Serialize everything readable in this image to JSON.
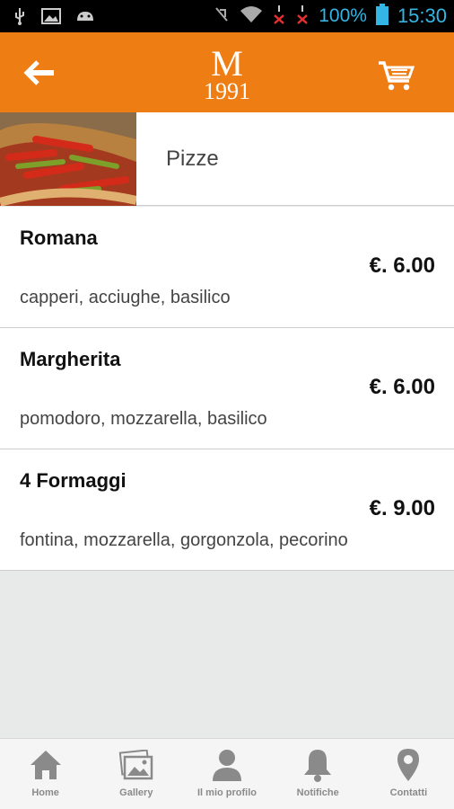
{
  "status_bar": {
    "battery": "100%",
    "time": "15:30",
    "icons": [
      "usb-icon",
      "image-icon",
      "android-icon",
      "mute-icon",
      "wifi-icon",
      "signal-off-icon",
      "signal-off-icon",
      "battery-icon"
    ],
    "accent_color": "#33b5e5"
  },
  "app_bar": {
    "color": "#ee7d14",
    "logo_letter": "M",
    "logo_year": "1991",
    "back_icon": "back-arrow-icon",
    "cart_icon": "cart-icon"
  },
  "category": {
    "title": "Pizze",
    "image": "pizza-photo"
  },
  "items": [
    {
      "name": "Romana",
      "price": "€. 6.00",
      "description": "capperi, acciughe, basilico"
    },
    {
      "name": "Margherita",
      "price": "€. 6.00",
      "description": "pomodoro, mozzarella, basilico"
    },
    {
      "name": "4 Formaggi",
      "price": "€. 9.00",
      "description": "fontina, mozzarella, gorgonzola, pecorino"
    }
  ],
  "bottom_nav": {
    "items": [
      {
        "label": "Home",
        "icon": "home-icon"
      },
      {
        "label": "Gallery",
        "icon": "gallery-icon"
      },
      {
        "label": "Il mio profilo",
        "icon": "profile-icon"
      },
      {
        "label": "Notifiche",
        "icon": "bell-icon"
      },
      {
        "label": "Contatti",
        "icon": "location-pin-icon"
      }
    ]
  }
}
